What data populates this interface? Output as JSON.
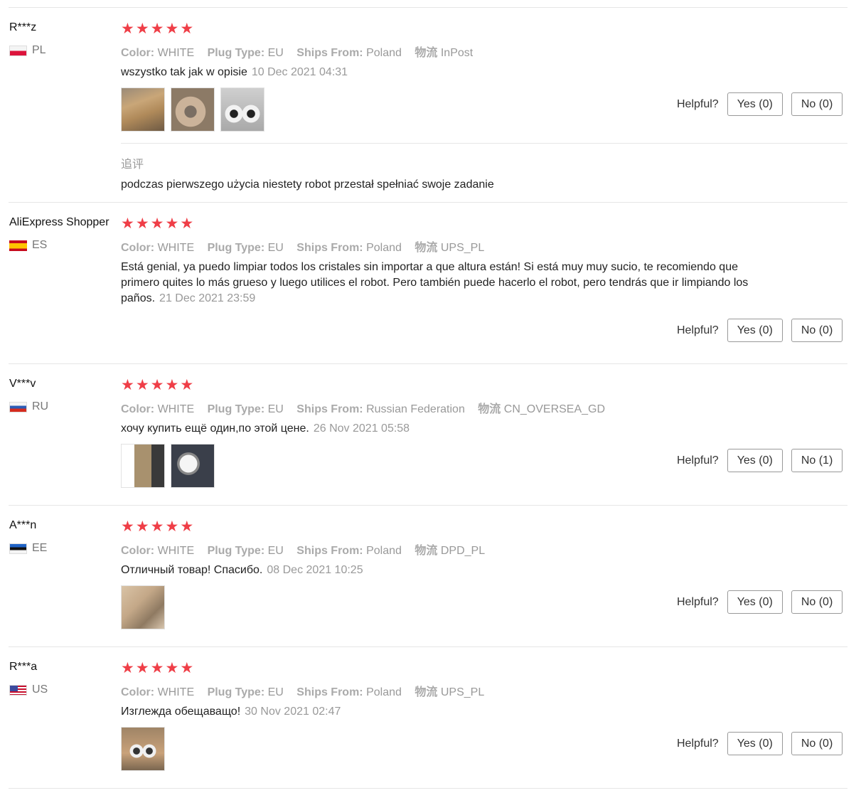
{
  "labels": {
    "helpful": "Helpful?",
    "color": "Color:",
    "plug": "Plug Type:",
    "ships": "Ships From:",
    "logistics": "物流"
  },
  "reviews": [
    {
      "user": "R***z",
      "country": "PL",
      "rating": 5,
      "color": "WHITE",
      "plug": "EU",
      "ships": "Poland",
      "logistics": "InPost",
      "text": "wszystko tak jak w opisie",
      "date": "10 Dec 2021 04:31",
      "yes": "Yes (0)",
      "no": "No (0)",
      "followup_title": "追评",
      "followup_text": "podczas pierwszego użycia niestety robot przestał spełniać swoje zadanie"
    },
    {
      "user": "AliExpress Shopper",
      "country": "ES",
      "rating": 5,
      "color": "WHITE",
      "plug": "EU",
      "ships": "Poland",
      "logistics": "UPS_PL",
      "text": "Está genial, ya puedo limpiar todos los cristales sin importar a que altura están! Si está muy muy sucio, te recomiendo que primero quites lo más grueso y luego utilices el robot. Pero también puede hacerlo el robot, pero tendrás que ir limpiando los paños.",
      "date": "21 Dec 2021 23:59",
      "yes": "Yes (0)",
      "no": "No (0)"
    },
    {
      "user": "V***v",
      "country": "RU",
      "rating": 5,
      "color": "WHITE",
      "plug": "EU",
      "ships": "Russian Federation",
      "logistics": "CN_OVERSEA_GD",
      "text": "хочу купить ещё один,по этой цене.",
      "date": "26 Nov 2021 05:58",
      "yes": "Yes (0)",
      "no": "No (1)"
    },
    {
      "user": "A***n",
      "country": "EE",
      "rating": 5,
      "color": "WHITE",
      "plug": "EU",
      "ships": "Poland",
      "logistics": "DPD_PL",
      "text": "Отличный товар! Спасибо.",
      "date": "08 Dec 2021 10:25",
      "yes": "Yes (0)",
      "no": "No (0)"
    },
    {
      "user": "R***a",
      "country": "US",
      "rating": 5,
      "color": "WHITE",
      "plug": "EU",
      "ships": "Poland",
      "logistics": "UPS_PL",
      "text": "Изглежда обещаващо!",
      "date": "30 Nov 2021 02:47",
      "yes": "Yes (0)",
      "no": "No (0)"
    }
  ]
}
